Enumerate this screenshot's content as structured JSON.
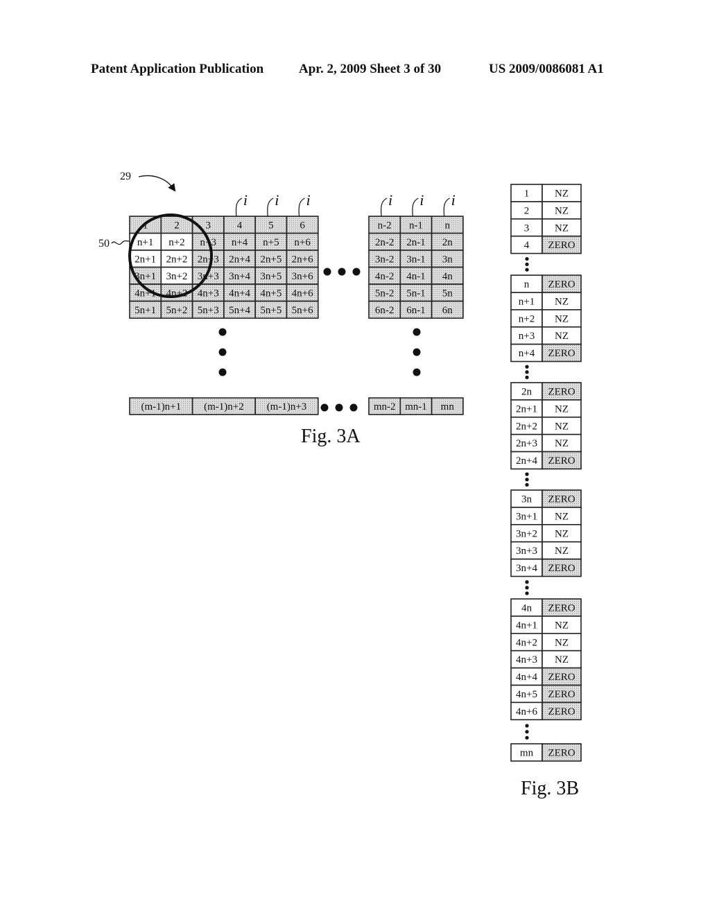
{
  "header": {
    "left": "Patent Application Publication",
    "middle": "Apr. 2, 2009   Sheet 3 of 30",
    "right": "US 2009/0086081 A1"
  },
  "colors": {
    "shade": "#d4d4d4",
    "white": "#ffffff",
    "line": "#222222"
  },
  "fig3a": {
    "caption": "Fig. 3A",
    "ref_matrix": "29",
    "ref_circle": "50",
    "index_label": "i",
    "left_grid": {
      "rows": [
        [
          {
            "t": "1",
            "s": 1
          },
          {
            "t": "2",
            "s": 1
          },
          {
            "t": "3",
            "s": 1
          },
          {
            "t": "4",
            "s": 1
          },
          {
            "t": "5",
            "s": 1
          },
          {
            "t": "6",
            "s": 1
          }
        ],
        [
          {
            "t": "n+1",
            "s": 0
          },
          {
            "t": "n+2",
            "s": 0
          },
          {
            "t": "n+3",
            "s": 1
          },
          {
            "t": "n+4",
            "s": 1
          },
          {
            "t": "n+5",
            "s": 1
          },
          {
            "t": "n+6",
            "s": 1
          }
        ],
        [
          {
            "t": "2n+1",
            "s": 0
          },
          {
            "t": "2n+2",
            "s": 0
          },
          {
            "t": "2n+3",
            "s": 1
          },
          {
            "t": "2n+4",
            "s": 1
          },
          {
            "t": "2n+5",
            "s": 1
          },
          {
            "t": "2n+6",
            "s": 1
          }
        ],
        [
          {
            "t": "3n+1",
            "s": 1
          },
          {
            "t": "3n+2",
            "s": 0
          },
          {
            "t": "3n+3",
            "s": 1
          },
          {
            "t": "3n+4",
            "s": 1
          },
          {
            "t": "3n+5",
            "s": 1
          },
          {
            "t": "3n+6",
            "s": 1
          }
        ],
        [
          {
            "t": "4n+1",
            "s": 1
          },
          {
            "t": "4n+2",
            "s": 1
          },
          {
            "t": "4n+3",
            "s": 1
          },
          {
            "t": "4n+4",
            "s": 1
          },
          {
            "t": "4n+5",
            "s": 1
          },
          {
            "t": "4n+6",
            "s": 1
          }
        ],
        [
          {
            "t": "5n+1",
            "s": 1
          },
          {
            "t": "5n+2",
            "s": 1
          },
          {
            "t": "5n+3",
            "s": 1
          },
          {
            "t": "5n+4",
            "s": 1
          },
          {
            "t": "5n+5",
            "s": 1
          },
          {
            "t": "5n+6",
            "s": 1
          }
        ]
      ]
    },
    "right_grid": {
      "rows": [
        [
          "n-2",
          "n-1",
          "n"
        ],
        [
          "2n-2",
          "2n-1",
          "2n"
        ],
        [
          "3n-2",
          "3n-1",
          "3n"
        ],
        [
          "4n-2",
          "4n-1",
          "4n"
        ],
        [
          "5n-2",
          "5n-1",
          "5n"
        ],
        [
          "6n-2",
          "6n-1",
          "6n"
        ]
      ]
    },
    "bottom_left_row": [
      "(m-1)n+1",
      "(m-1)n+2",
      "(m-1)n+3"
    ],
    "bottom_right_row": [
      "mn-2",
      "mn-1",
      "mn"
    ]
  },
  "fig3b": {
    "caption": "Fig. 3B",
    "groups": [
      [
        [
          "1",
          "NZ"
        ],
        [
          "2",
          "NZ"
        ],
        [
          "3",
          "NZ"
        ],
        [
          "4",
          "ZERO"
        ]
      ],
      [
        [
          "n",
          "ZERO"
        ],
        [
          "n+1",
          "NZ"
        ],
        [
          "n+2",
          "NZ"
        ],
        [
          "n+3",
          "NZ"
        ],
        [
          "n+4",
          "ZERO"
        ]
      ],
      [
        [
          "2n",
          "ZERO"
        ],
        [
          "2n+1",
          "NZ"
        ],
        [
          "2n+2",
          "NZ"
        ],
        [
          "2n+3",
          "NZ"
        ],
        [
          "2n+4",
          "ZERO"
        ]
      ],
      [
        [
          "3n",
          "ZERO"
        ],
        [
          "3n+1",
          "NZ"
        ],
        [
          "3n+2",
          "NZ"
        ],
        [
          "3n+3",
          "NZ"
        ],
        [
          "3n+4",
          "ZERO"
        ]
      ],
      [
        [
          "4n",
          "ZERO"
        ],
        [
          "4n+1",
          "NZ"
        ],
        [
          "4n+2",
          "NZ"
        ],
        [
          "4n+3",
          "NZ"
        ],
        [
          "4n+4",
          "ZERO"
        ],
        [
          "4n+5",
          "ZERO"
        ],
        [
          "4n+6",
          "ZERO"
        ]
      ],
      [
        [
          "mn",
          "ZERO"
        ]
      ]
    ]
  }
}
